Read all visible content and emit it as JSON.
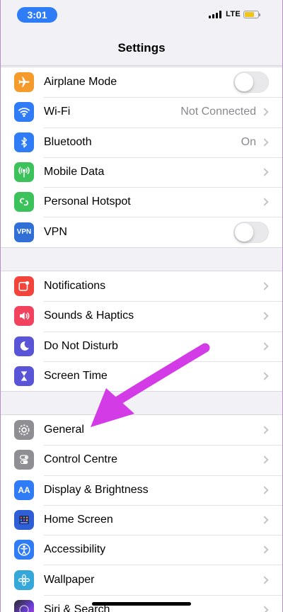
{
  "status_bar": {
    "time": "3:01",
    "network": "LTE"
  },
  "nav": {
    "title": "Settings"
  },
  "groups": [
    {
      "rows": [
        {
          "label": "Airplane Mode",
          "icon": "airplane-icon",
          "color": "#f59b2b"
        },
        {
          "label": "Wi-Fi",
          "value": "Not Connected",
          "icon": "wifi-icon",
          "color": "#2f7cf6"
        },
        {
          "label": "Bluetooth",
          "value": "On",
          "icon": "bluetooth-icon",
          "color": "#2f7cf6"
        },
        {
          "label": "Mobile Data",
          "icon": "antenna-icon",
          "color": "#3bc25b"
        },
        {
          "label": "Personal Hotspot",
          "icon": "hotspot-icon",
          "color": "#3bc25b"
        },
        {
          "label": "VPN",
          "icon_text": "VPN",
          "icon": "vpn-icon",
          "color": "#2f6fd6"
        }
      ]
    },
    {
      "rows": [
        {
          "label": "Notifications",
          "icon": "notifications-icon",
          "color": "#f2443b"
        },
        {
          "label": "Sounds & Haptics",
          "icon": "speaker-icon",
          "color": "#f2435e"
        },
        {
          "label": "Do Not Disturb",
          "icon": "moon-icon",
          "color": "#5a55d6"
        },
        {
          "label": "Screen Time",
          "icon": "hourglass-icon",
          "color": "#5a55d6"
        }
      ]
    },
    {
      "rows": [
        {
          "label": "General",
          "icon": "gear-icon",
          "color": "#8e8e93"
        },
        {
          "label": "Control Centre",
          "icon": "toggles-icon",
          "color": "#8e8e93"
        },
        {
          "label": "Display & Brightness",
          "icon_text": "AA",
          "icon": "display-icon",
          "color": "#2f7cf6"
        },
        {
          "label": "Home Screen",
          "icon": "home-screen-icon",
          "color": "#2f5fd6"
        },
        {
          "label": "Accessibility",
          "icon": "accessibility-icon",
          "color": "#2f7cf6"
        },
        {
          "label": "Wallpaper",
          "icon": "wallpaper-icon",
          "color": "#35a7d8"
        },
        {
          "label": "Siri & Search",
          "icon": "siri-icon",
          "color": "#333333"
        }
      ]
    }
  ],
  "annotation": {
    "color": "#d23be6"
  }
}
